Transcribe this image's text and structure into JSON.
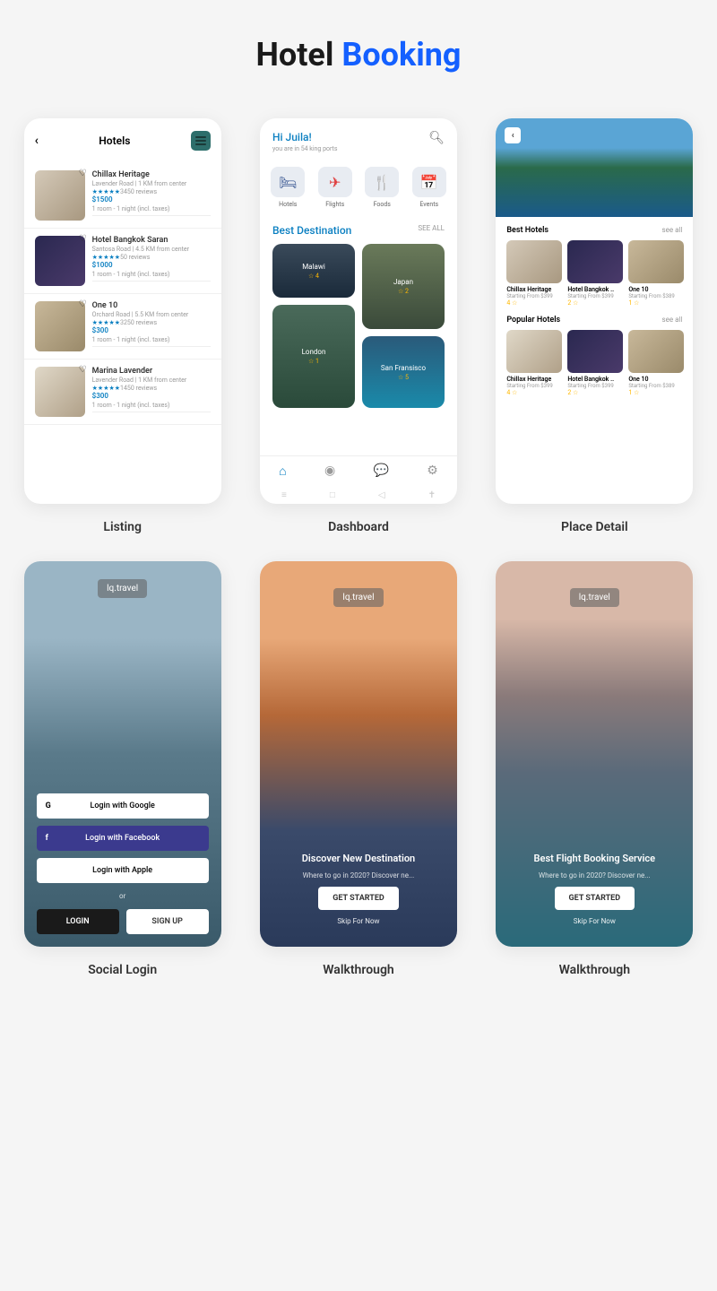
{
  "title": {
    "part1": "Hotel ",
    "part2": "Booking"
  },
  "screens": {
    "listing": {
      "label": "Listing",
      "header": "Hotels",
      "hotels": [
        {
          "name": "Chillax Heritage",
          "loc": "Lavender Road | 1 KM from center",
          "stars": "★★★★★",
          "reviews": "3450 reviews",
          "price": "$1500",
          "room": "1 room - 1 night (incl. taxes)"
        },
        {
          "name": "Hotel Bangkok Saran",
          "loc": "Santosa Road | 4.5 KM from center",
          "stars": "★★★★★",
          "reviews": "50 reviews",
          "price": "$1000",
          "room": "1 room - 1 night (incl. taxes)"
        },
        {
          "name": "One 10",
          "loc": "Orchard Road | 5.5 KM from center",
          "stars": "★★★★★",
          "reviews": "3250 reviews",
          "price": "$300",
          "room": "1 room - 1 night (incl. taxes)"
        },
        {
          "name": "Marina Lavender",
          "loc": "Lavender Road | 1 KM from center",
          "stars": "★★★★★",
          "reviews": "1450 reviews",
          "price": "$300",
          "room": "1 room - 1 night (incl. taxes)"
        }
      ]
    },
    "dashboard": {
      "label": "Dashboard",
      "greeting": "Hi Juila!",
      "sub": "you are in 54 king ports",
      "cats": [
        {
          "icon": "🛏",
          "label": "Hotels",
          "color": "#2a4a8a"
        },
        {
          "icon": "✈",
          "label": "Flights",
          "color": "#e04040"
        },
        {
          "icon": "🍴",
          "label": "Foods",
          "color": "#2a3a6a"
        },
        {
          "icon": "📅",
          "label": "Events",
          "color": "#f0a020"
        }
      ],
      "section": "Best Destination",
      "seeall": "SEE ALL",
      "dests": [
        {
          "name": "Malawi",
          "rating": "☆ 4"
        },
        {
          "name": "Japan",
          "rating": "☆ 2"
        },
        {
          "name": "London",
          "rating": "☆ 1"
        },
        {
          "name": "San Fransisco",
          "rating": "☆ 5"
        }
      ]
    },
    "detail": {
      "label": "Place Detail",
      "sections": [
        {
          "title": "Best Hotels",
          "seeall": "see all"
        },
        {
          "title": "Popular Hotels",
          "seeall": "see all"
        }
      ],
      "cards": [
        {
          "name": "Chillax Heritage",
          "price": "Starting From $399",
          "rating": "4 ☆"
        },
        {
          "name": "Hotel Bangkok ..",
          "price": "Starting From $399",
          "rating": "2 ☆"
        },
        {
          "name": "One 10",
          "price": "Starting From $389",
          "rating": "1 ☆"
        }
      ]
    },
    "social": {
      "label": "Social Login",
      "brand": "lq.travel",
      "google": "Login with Google",
      "facebook": "Login with Facebook",
      "apple": "Login with Apple",
      "or": "or",
      "login": "LOGIN",
      "signup": "SIGN UP"
    },
    "walk1": {
      "label": "Walkthrough",
      "brand": "lq.travel",
      "title": "Discover New Destination",
      "sub": "Where to go in 2020? Discover ne...",
      "cta": "GET STARTED",
      "skip": "Skip For Now"
    },
    "walk2": {
      "label": "Walkthrough",
      "brand": "lq.travel",
      "title": "Best Flight Booking Service",
      "sub": "Where to go in 2020? Discover ne...",
      "cta": "GET STARTED",
      "skip": "Skip For Now"
    }
  }
}
